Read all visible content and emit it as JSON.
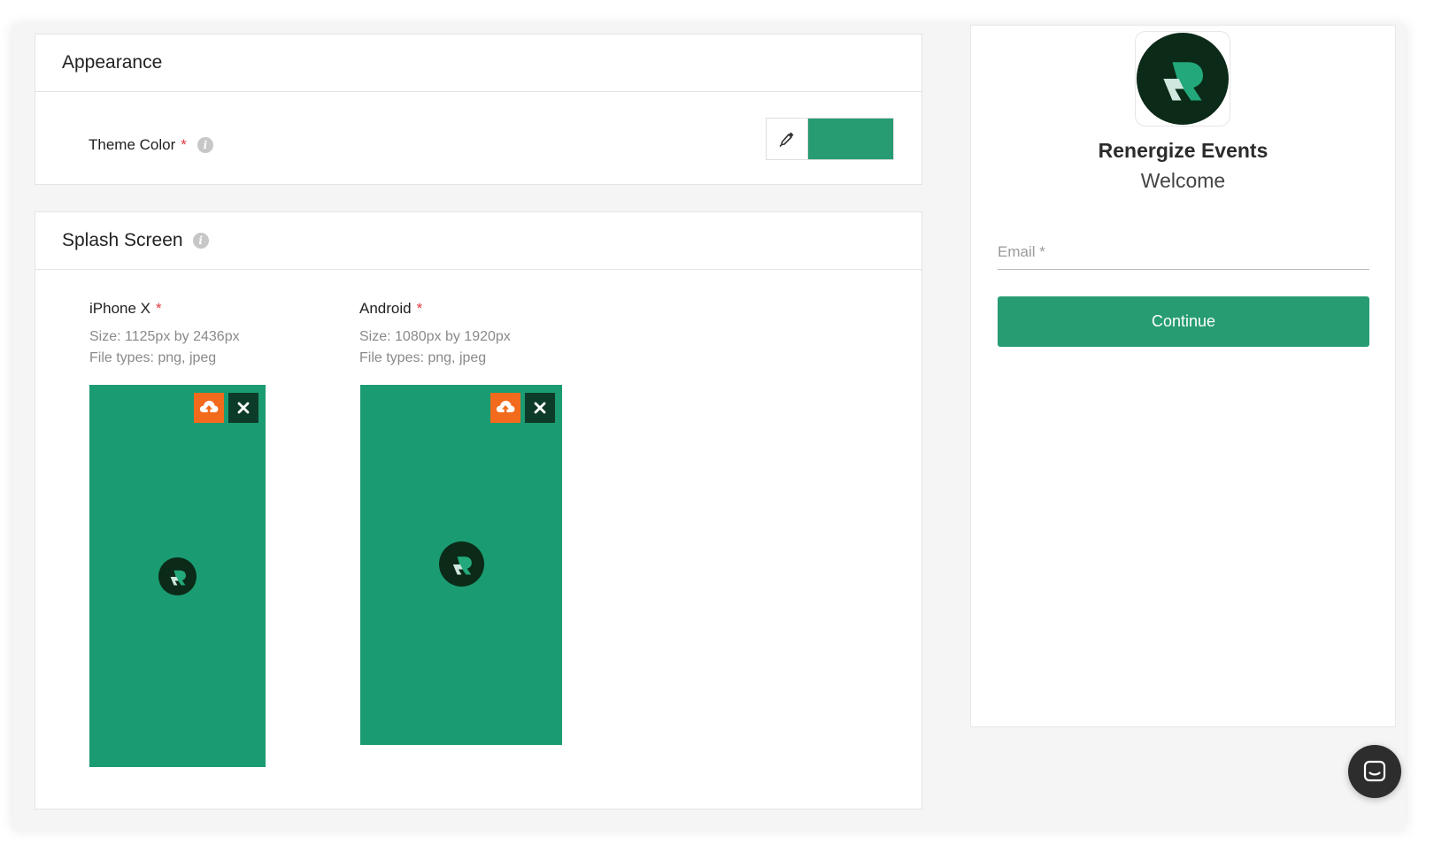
{
  "colors": {
    "theme": "#1b9b72",
    "theme_swatch": "#279c73",
    "upload_orange": "#f26b1d",
    "remove_dark": "#0d3b2a",
    "logo_dark": "#0b2a17",
    "logo_green": "#23a87b",
    "logo_light": "#cfe7df"
  },
  "appearance": {
    "title": "Appearance",
    "theme_color_label": "Theme Color",
    "required_mark": "*",
    "info_glyph": "i",
    "picker_icon": "eyedropper-icon"
  },
  "splash": {
    "title": "Splash Screen",
    "info_glyph": "i",
    "iphone": {
      "title": "iPhone X",
      "required_mark": "*",
      "size": "Size: 1125px by 2436px",
      "types": "File types: png, jpeg"
    },
    "android": {
      "title": "Android",
      "required_mark": "*",
      "size": "Size: 1080px by 1920px",
      "types": "File types: png, jpeg"
    },
    "upload_icon": "cloud-upload-icon",
    "remove_icon": "close-icon"
  },
  "preview": {
    "org_name": "Renergize Events",
    "welcome": "Welcome",
    "email_placeholder": "Email *",
    "continue_label": "Continue"
  },
  "chat": {
    "icon": "chat-icon"
  }
}
